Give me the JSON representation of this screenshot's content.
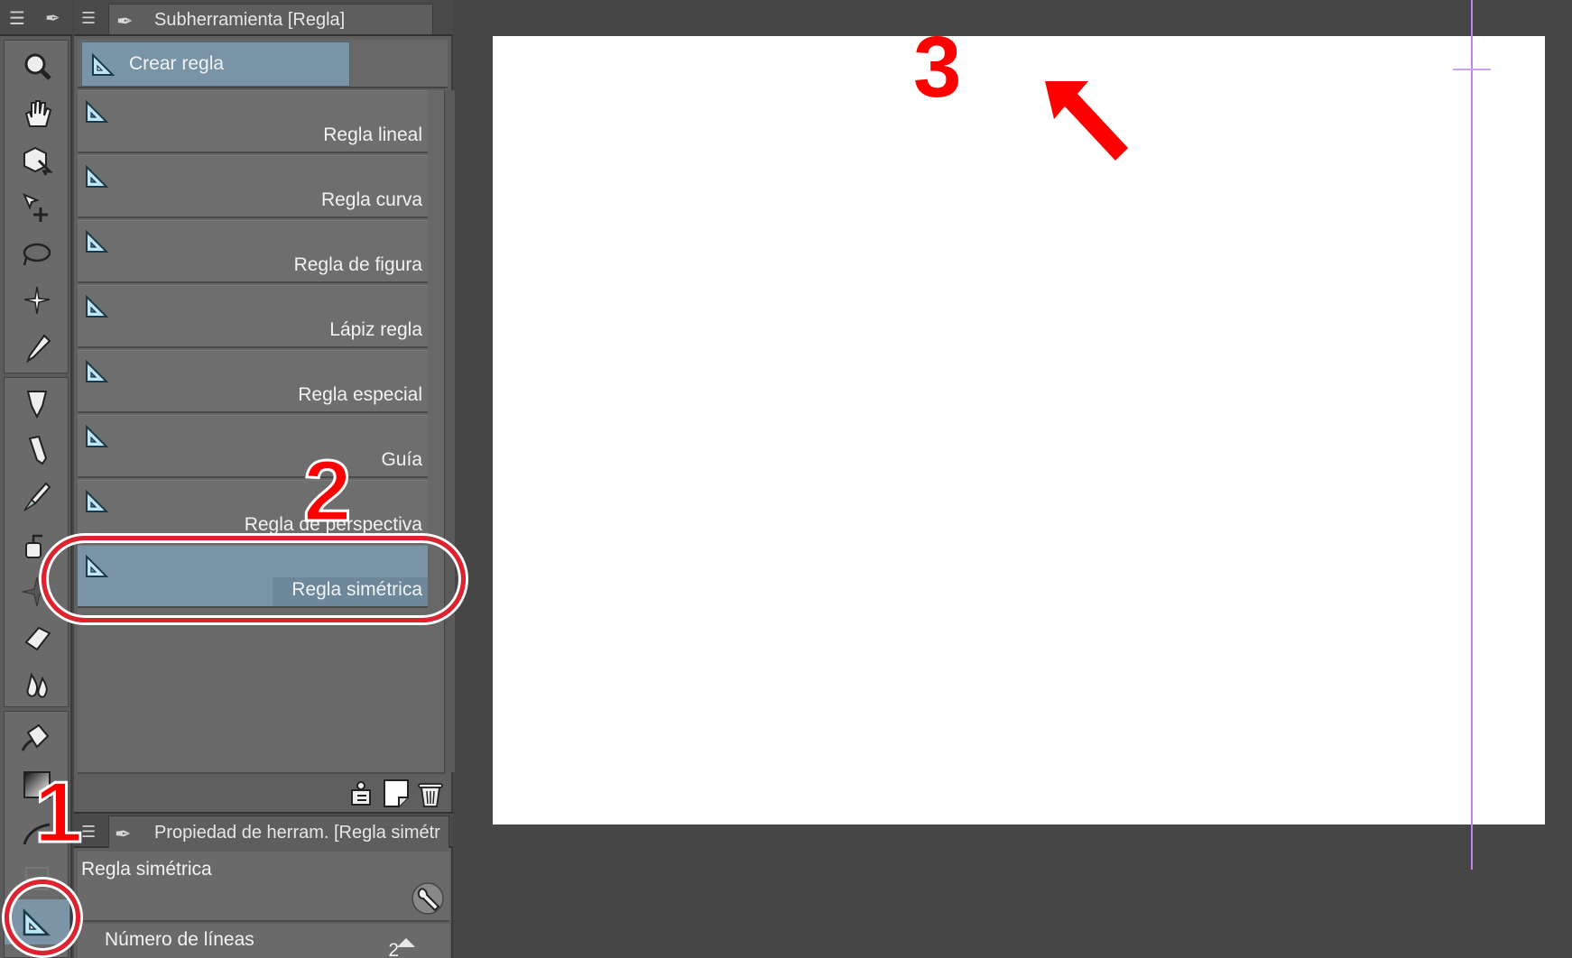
{
  "subtool_panel": {
    "title": "Subherramienta [Regla]",
    "create_button": "Crear regla",
    "items": [
      {
        "label": "Regla lineal"
      },
      {
        "label": "Regla curva"
      },
      {
        "label": "Regla de figura"
      },
      {
        "label": "Lápiz regla"
      },
      {
        "label": "Regla especial"
      },
      {
        "label": "Guía"
      },
      {
        "label": "Regla de perspectiva"
      },
      {
        "label": "Regla simétrica"
      }
    ],
    "selected_index": 7
  },
  "property_panel": {
    "title": "Propiedad de herram. [Regla simétr",
    "tool_name": "Regla simétrica",
    "rows": [
      {
        "label": "Número de líneas",
        "value": "2"
      }
    ]
  },
  "annotations": {
    "step1": "1",
    "step2": "2",
    "step3": "3"
  },
  "colors": {
    "annotation_red": "#ff0000",
    "symmetry_line": "#b985e8",
    "selected_item": "#7894a6"
  }
}
